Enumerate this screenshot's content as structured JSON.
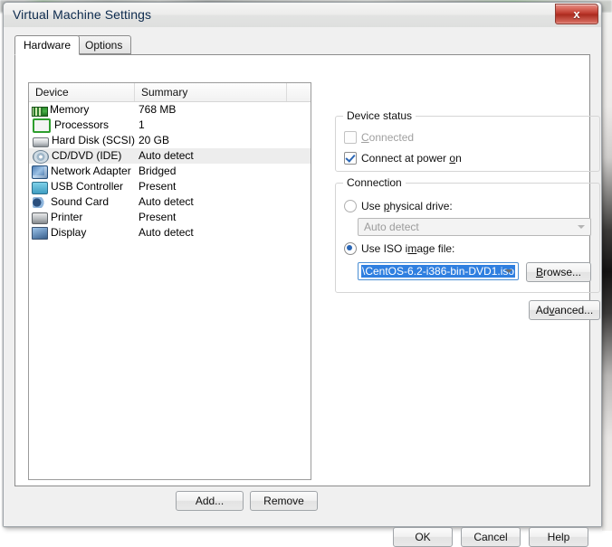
{
  "window": {
    "title": "Virtual Machine Settings",
    "close_label": "x"
  },
  "tabs": [
    {
      "label": "Hardware",
      "active": true
    },
    {
      "label": "Options",
      "active": false
    }
  ],
  "device_list": {
    "columns": [
      "Device",
      "Summary",
      ""
    ],
    "rows": [
      {
        "icon": "memory-icon",
        "name": "Memory",
        "summary": "768 MB",
        "selected": false
      },
      {
        "icon": "processor-icon",
        "name": "Processors",
        "summary": "1",
        "selected": false
      },
      {
        "icon": "hard-disk-icon",
        "name": "Hard Disk (SCSI)",
        "summary": "20 GB",
        "selected": false
      },
      {
        "icon": "cd-dvd-icon",
        "name": "CD/DVD (IDE)",
        "summary": "Auto detect",
        "selected": true
      },
      {
        "icon": "network-adapter-icon",
        "name": "Network Adapter",
        "summary": "Bridged",
        "selected": false
      },
      {
        "icon": "usb-controller-icon",
        "name": "USB Controller",
        "summary": "Present",
        "selected": false
      },
      {
        "icon": "sound-card-icon",
        "name": "Sound Card",
        "summary": "Auto detect",
        "selected": false
      },
      {
        "icon": "printer-icon",
        "name": "Printer",
        "summary": "Present",
        "selected": false
      },
      {
        "icon": "display-icon",
        "name": "Display",
        "summary": "Auto detect",
        "selected": false
      }
    ],
    "add_label": "Add...",
    "remove_label": "Remove"
  },
  "device_status": {
    "group_title": "Device status",
    "connected_label": "Connected",
    "connected_checked": false,
    "connected_disabled": true,
    "connect_at_power_on_label": "Connect at power on",
    "connect_at_power_on_checked": true
  },
  "connection": {
    "group_title": "Connection",
    "physical_drive_label": "Use physical drive:",
    "physical_drive_selected": false,
    "physical_drive_value": "Auto detect",
    "iso_label": "Use ISO image file:",
    "iso_selected": true,
    "iso_value": "\\CentOS-6.2-i386-bin-DVD1.iso",
    "browse_label": "Browse...",
    "advanced_label": "Advanced..."
  },
  "footer": {
    "ok_label": "OK",
    "cancel_label": "Cancel",
    "help_label": "Help"
  },
  "colors": {
    "accent_blue": "#2f7fe0",
    "close_red": "#b93327",
    "dialog_bg": "#f0f0f0",
    "panel_bg": "#ffffff",
    "selection_row": "#ededed"
  }
}
